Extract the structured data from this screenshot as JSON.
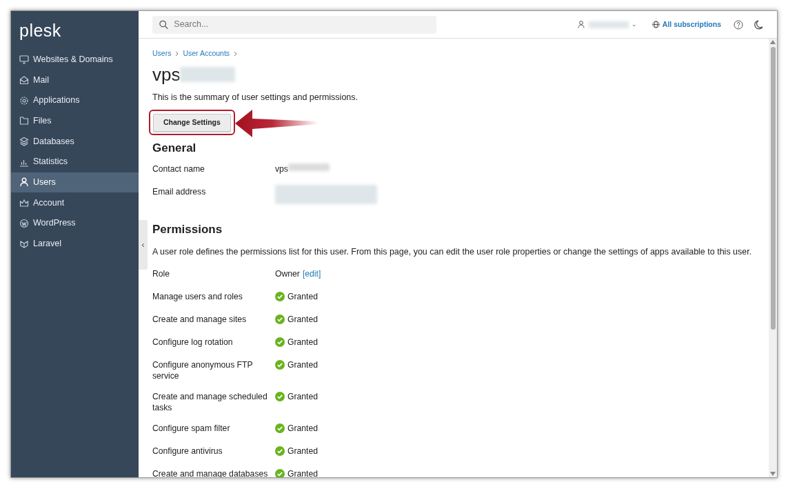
{
  "sidebar": {
    "logo": "plesk",
    "items": [
      {
        "label": "Websites & Domains",
        "selected": false
      },
      {
        "label": "Mail",
        "selected": false
      },
      {
        "label": "Applications",
        "selected": false
      },
      {
        "label": "Files",
        "selected": false
      },
      {
        "label": "Databases",
        "selected": false
      },
      {
        "label": "Statistics",
        "selected": false
      },
      {
        "label": "Users",
        "selected": true
      },
      {
        "label": "Account",
        "selected": false
      },
      {
        "label": "WordPress",
        "selected": false
      },
      {
        "label": "Laravel",
        "selected": false
      }
    ]
  },
  "topbar": {
    "search": {
      "placeholder": "Search..."
    },
    "user_menu": {
      "redacted": true,
      "caret": "⌄"
    },
    "subscriptions": "All subscriptions"
  },
  "collapse_handle": "‹",
  "breadcrumbs": [
    "Users",
    "User Accounts"
  ],
  "title": {
    "text": "vps",
    "redacted": true
  },
  "description": "This is the summary of user settings and permissions.",
  "change_settings_button": "Change Settings",
  "general": {
    "heading": "General",
    "rows": [
      {
        "kind": "text",
        "label": "Contact name",
        "value": "vps",
        "redacted": true
      },
      {
        "kind": "text",
        "label": "Email address",
        "redacted": true
      }
    ]
  },
  "permissions": {
    "heading": "Permissions",
    "description": "A user role defines the permissions list for this user. From this page, you can edit the user role properties or change the settings of apps available to this user.",
    "rows": [
      {
        "kind": "role",
        "label": "Role",
        "value": "Owner",
        "link": "[edit]"
      },
      {
        "kind": "permission",
        "label": "Manage users and roles",
        "value": "Granted",
        "granted": true
      },
      {
        "kind": "permission",
        "label": "Create and manage sites",
        "value": "Granted",
        "granted": true
      },
      {
        "kind": "permission",
        "label": "Configure log rotation",
        "value": "Granted",
        "granted": true
      },
      {
        "kind": "permission",
        "label": "Configure anonymous FTP service",
        "value": "Granted",
        "granted": true
      },
      {
        "kind": "permission",
        "label": "Create and manage scheduled tasks",
        "value": "Granted",
        "granted": true
      },
      {
        "kind": "permission",
        "label": "Configure spam filter",
        "value": "Granted",
        "granted": true
      },
      {
        "kind": "permission",
        "label": "Configure antivirus",
        "value": "Granted",
        "granted": true
      },
      {
        "kind": "permission",
        "label": "Create and manage databases",
        "value": "Granted",
        "granted": true
      }
    ]
  }
}
